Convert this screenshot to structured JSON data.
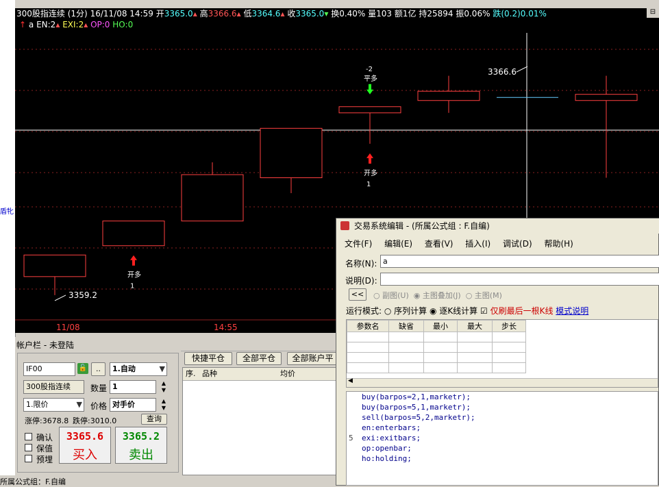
{
  "chart_header": {
    "instrument": "300股指连续",
    "period": "(1分)",
    "datetime": "16/11/08 14:59",
    "open_label": "开",
    "open": "3365.0",
    "high_label": "高",
    "high": "3366.6",
    "low_label": "低",
    "low": "3364.6",
    "close_label": "收",
    "close": "3365.0",
    "turnover": "换0.40%",
    "volume": "量103",
    "amount": "额1亿",
    "position": "持25894",
    "amplitude": "振0.06%",
    "change": "跌(0.2)0.01%"
  },
  "indicator_line": {
    "name": "a",
    "en": "EN:2",
    "exi": "EXI:2",
    "op": "OP:0",
    "ho": "HO:0"
  },
  "chart_data": {
    "type": "candlestick",
    "high_marker": "3366.6",
    "low_marker": "3359.2",
    "x_ticks": [
      "11/08",
      "14:55"
    ],
    "candles": [
      {
        "open": 3360.5,
        "close": 3359.8,
        "high": 3360.5,
        "low": 3359.2
      },
      {
        "open": 3360.8,
        "close": 3361.6,
        "high": 3361.6,
        "low": 3360.8
      },
      {
        "open": 3361.6,
        "close": 3363.1,
        "high": 3363.5,
        "low": 3361.6
      },
      {
        "open": 3364.6,
        "close": 3363.0,
        "high": 3364.6,
        "low": 3362.5
      },
      {
        "open": 3365.3,
        "close": 3365.1,
        "high": 3365.1,
        "low": 3364.1
      },
      {
        "open": 3365.8,
        "close": 3365.5,
        "high": 3366.3,
        "low": 3365.1
      },
      {
        "open": 3365.6,
        "close": 3365.6,
        "high": 3365.6,
        "low": 3365.6
      },
      {
        "open": 3365.7,
        "close": 3365.5,
        "high": 3366.3,
        "low": 3363.0
      }
    ],
    "signals": [
      {
        "type": "open_long",
        "label": "开多",
        "count": "1",
        "bar": 1
      },
      {
        "type": "open_long",
        "label": "开多",
        "count": "1",
        "bar": 4
      },
      {
        "type": "close_long",
        "label": "平多",
        "count": "-2",
        "bar": 4
      }
    ]
  },
  "account": {
    "title": "帐户栏 - 未登陆",
    "code": "IF00",
    "more": "..",
    "mode": "1.自动",
    "name": "300股指连续",
    "qty_label": "数量",
    "qty": "1",
    "price_type": "1.限价",
    "price_label": "价格",
    "price": "对手价",
    "limit_up": "涨停:3678.8",
    "limit_down": "跌停:3010.0",
    "query": "查询",
    "confirm": "确认",
    "protect": "保值",
    "preorder": "预埋",
    "buy_price": "3365.6",
    "buy_label": "买入",
    "sell_price": "3365.2",
    "sell_label": "卖出"
  },
  "positions": {
    "quick_close": "快捷平仓",
    "close_all": "全部平仓",
    "close_all_accounts": "全部账户平",
    "col_no": "序.",
    "col_symbol": "品种",
    "col_avg": "均价"
  },
  "dialog": {
    "title": "交易系统编辑 - (所属公式组 : F.自编)",
    "menu": [
      "文件(F)",
      "编辑(E)",
      "查看(V)",
      "插入(I)",
      "调试(D)",
      "帮助(H)"
    ],
    "name_label": "名称(N):",
    "name_value": "a",
    "desc_label": "说明(D):",
    "desc_value": "",
    "back": "<<",
    "sub_chart": "副图(U)",
    "main_overlay": "主图叠加(J)",
    "main_chart": "主图(M)",
    "run_mode_label": "运行模式:",
    "mode_series": "序列计算",
    "mode_tick": "逐K线计算",
    "refresh_last": "仅刷最后一根K线",
    "mode_help": "模式说明",
    "param_cols": [
      "参数名",
      "缺省",
      "最小",
      "最大",
      "步长"
    ],
    "line_marker": "5",
    "code_lines": [
      "buy(barpos=2,1,marketr);",
      "buy(barpos=5,1,marketr);",
      "sell(barpos=5,2,marketr);",
      "en:enterbars;",
      "exi:exitbars;",
      "op:openbar;",
      "ho:holding;"
    ]
  },
  "status_bar": "所属公式组：F.自编",
  "left_side_text": "盾牝"
}
